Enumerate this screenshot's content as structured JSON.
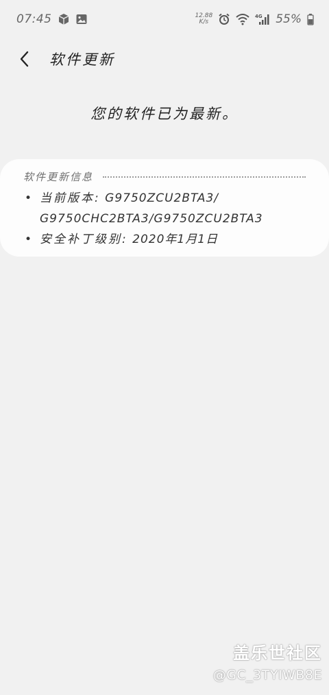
{
  "status_bar": {
    "time": "07:45",
    "speed_value": "12.88",
    "speed_unit": "K/s",
    "network": "4G",
    "battery": "55%"
  },
  "header": {
    "title": "软件更新",
    "back_icon": "back-arrow-icon"
  },
  "main": {
    "message": "您的软件已为最新。"
  },
  "info_card": {
    "title": "软件更新信息",
    "version_label": "当前版本:",
    "version_value": "G9750ZCU2BTA3/",
    "version_value_cont": "G9750CHC2BTA3/G9750ZCU2BTA3",
    "patch_label": "安全补丁级别:",
    "patch_value": "2020年1月1日"
  },
  "watermark": {
    "brand": "盖乐世社区",
    "user": "@GC_3TYIWB8E"
  },
  "colors": {
    "background": "#f1f1f1",
    "card": "#fdfdfd",
    "text": "#222222",
    "muted": "#6f6f6f"
  }
}
